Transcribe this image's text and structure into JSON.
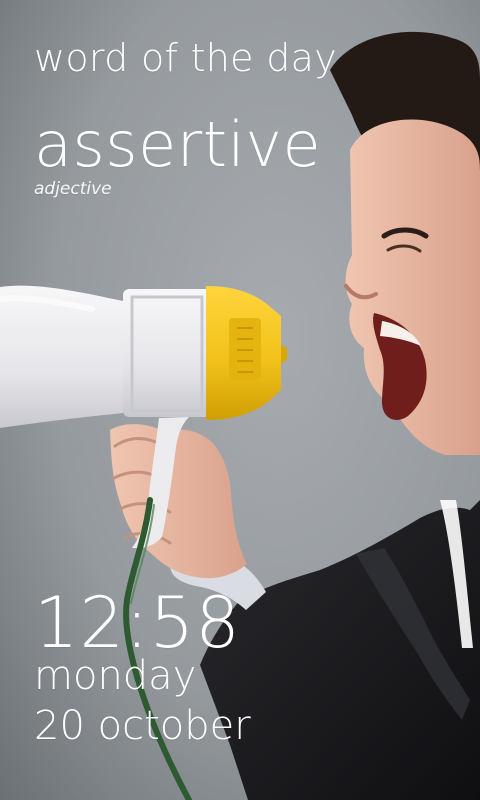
{
  "lockscreen": {
    "title": "word of the day",
    "word": "assertive",
    "part_of_speech": "adjective",
    "time": "12:58",
    "day": "monday",
    "date": "20 october"
  },
  "background": {
    "subject": "man shouting into megaphone",
    "colors": {
      "wall": "#8f9397",
      "megaphone_white": "#ededf0",
      "megaphone_yellow": "#f1c21b",
      "suit": "#1c1c1f",
      "skin": "#e6b9a3"
    }
  }
}
